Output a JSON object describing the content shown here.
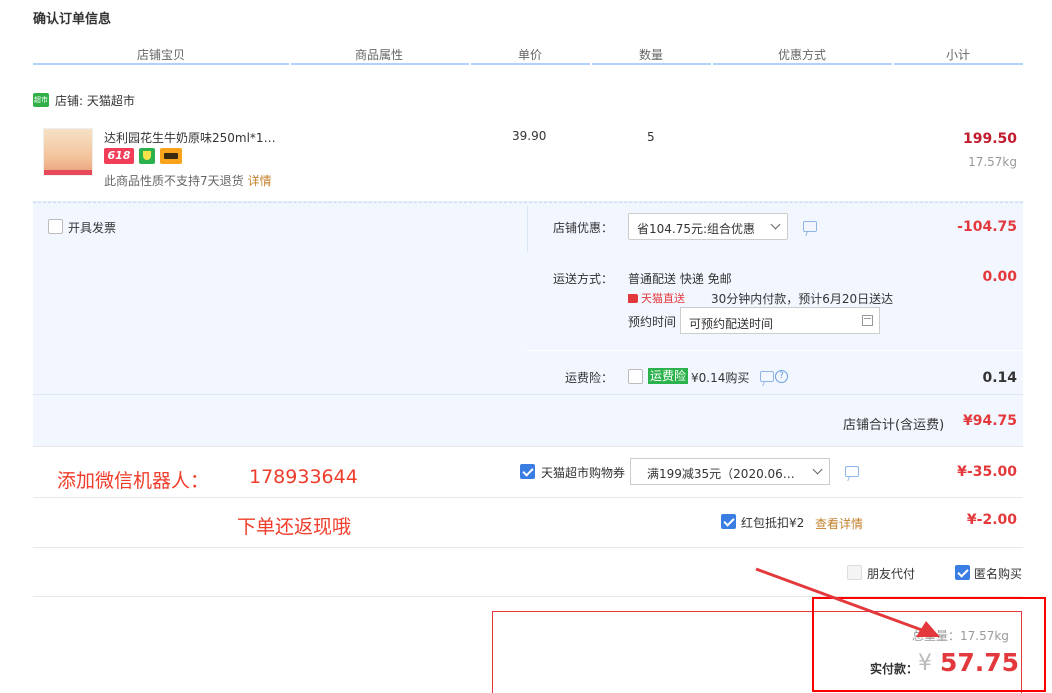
{
  "page": {
    "title": "确认订单信息"
  },
  "table_headers": [
    "店铺宝贝",
    "商品属性",
    "单价",
    "数量",
    "优惠方式",
    "小计"
  ],
  "store": {
    "icon_text": "超市",
    "label": "店铺: 天猫超市"
  },
  "product": {
    "name": "达利园花生牛奶原味250ml*1…",
    "badge_618": "618",
    "return_note": "此商品性质不支持7天退货",
    "return_link": "详情",
    "unit_price": "39.90",
    "quantity": "5",
    "subtotal": "199.50",
    "weight": "17.57kg"
  },
  "invoice": {
    "label": "开具发票",
    "checked": false
  },
  "store_discount": {
    "label": "店铺优惠：",
    "selected": "省104.75元:组合优惠",
    "amount": "-104.75"
  },
  "shipping": {
    "label": "运送方式：",
    "method": "普通配送 快递 免邮",
    "tmall_logo_text": "天猫直送",
    "delivery_note": "30分钟内付款，预计6月20日送达",
    "appoint_label": "预约时间",
    "appoint_value": "可预约配送时间",
    "amount": "0.00"
  },
  "insurance": {
    "label": "运费险：",
    "tag": "运费险",
    "price": "¥0.14购买",
    "help": "?",
    "amount": "0.14"
  },
  "store_total": {
    "label": "店铺合计(含运费)",
    "amount": "¥94.75"
  },
  "overlay_text": {
    "line1_label": "添加微信机器人：",
    "line1_number": "178933644",
    "line2": "下单还返现哦"
  },
  "coupon": {
    "label": "天猫超市购物券",
    "selected": "满199减35元（2020.06…",
    "amount": "¥-35.00",
    "checked": true
  },
  "red_packet": {
    "label": "红包抵扣¥2",
    "link": "查看详情",
    "amount": "¥-2.00",
    "checked": true
  },
  "options": {
    "friend_pay": "朋友代付",
    "anonymous": "匿名购买",
    "anonymous_checked": true
  },
  "summary": {
    "weight_label": "总重量：17.57kg",
    "pay_label": "实付款：",
    "currency": "¥",
    "pay_amount": "57.75"
  },
  "colors": {
    "accent_red": "#e4393c",
    "panel_bg": "#f2f7ff",
    "header_line": "#b2d1ff",
    "annotation_red": "#f03c2a"
  }
}
